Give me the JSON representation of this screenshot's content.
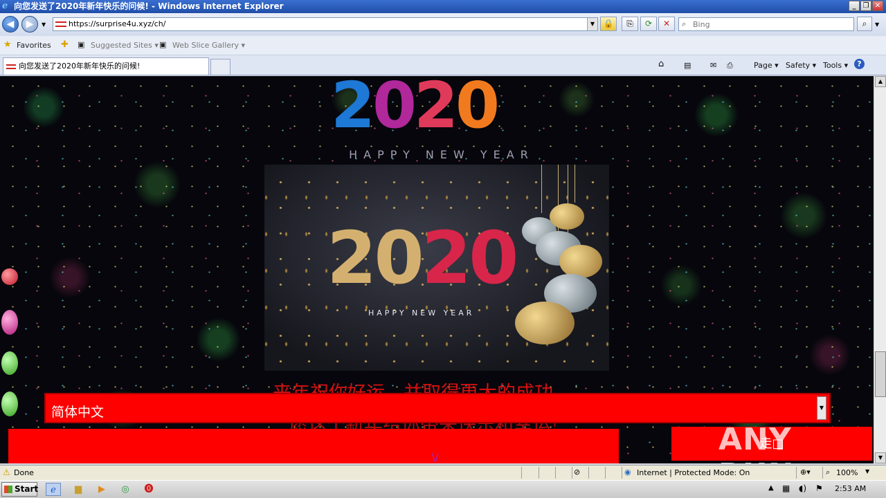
{
  "window": {
    "title": "向您发送了2020年新年快乐的问候! - Windows Internet Explorer",
    "minimize_glyph": "_",
    "restore_glyph": "❐",
    "close_glyph": "✕"
  },
  "navbar": {
    "back_glyph": "◀",
    "forward_glyph": "▶",
    "url": "https://surprise4u.xyz/ch/",
    "search_placeholder": "Bing"
  },
  "favorites_bar": {
    "favorites_label": "Favorites",
    "suggested_sites_label": "Suggested Sites ▾",
    "web_slice_label": "Web Slice Gallery ▾"
  },
  "tabs": [
    {
      "label": "向您发送了2020年新年快乐的问候!"
    }
  ],
  "command_bar": {
    "page_label": "Page ▾",
    "safety_label": "Safety ▾",
    "tools_label": "Tools ▾",
    "help_glyph": "?"
  },
  "page": {
    "logo_digits": [
      "2",
      "0",
      "2",
      "0"
    ],
    "logo_subtitle": "HAPPY NEW YEAR",
    "card_year_gold": "20",
    "card_year_red": "20",
    "card_subtitle": "HAPPY NEW YEAR",
    "greeting_line1": "来年祝你好运，并取得更大的成功",
    "greeting_line2": "愿这个新年给你带来快乐和幸运!",
    "language_select_value": "简体中文",
    "go_button_label": "走□",
    "bottom_mark": "\\/"
  },
  "watermark": "ANY RUN",
  "status_bar": {
    "status_text": "Done",
    "zone_text": "Internet | Protected Mode: On",
    "zoom_text": "100%"
  },
  "taskbar": {
    "start_label": "Start",
    "clock": "2:53 AM"
  },
  "colors": {
    "accent_red": "#ff0000",
    "greeting_red": "#d41010",
    "ie_titlebar": "#1f4ea8"
  }
}
